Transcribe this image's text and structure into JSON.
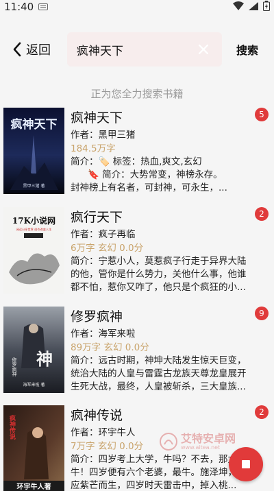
{
  "status_bar": {
    "time": "11:40"
  },
  "header": {
    "back_label": "返回",
    "search_value": "疯神天下",
    "search_button": "搜索"
  },
  "status_message": "正为您全力搜索书籍",
  "results": [
    {
      "title": "疯神天下",
      "badge": "5",
      "author": "作者：黑甲三猪",
      "meta": "184.5万字",
      "intro1": "简介：🏷️ 标签：热血,爽文,玄幻",
      "intro2": "🔖 简介：大势常变，神榜永存。",
      "intro3": "封神榜上有名者，可封神，可永生，...",
      "cover": {
        "line1": "疯神天下",
        "line2": "黑甲三猪 著"
      }
    },
    {
      "title": "疯行天下",
      "badge": "2",
      "author": "作者：疯子再临",
      "meta": "6万字  玄幻  0.0分",
      "intro1": "简介：宁惹小人，莫惹疯子行走于异界大陆",
      "intro2": "的他，管你是什么势力，关他什么事，他谁",
      "intro3": "都不怕，惹你又咋了，他只是个疯狂的小...",
      "cover": {
        "line1": "17K小说网",
        "line2": "阅读分享世界  创作改变人生"
      }
    },
    {
      "title": "修罗疯神",
      "badge": "9",
      "author": "作者：海军来啦",
      "meta": "89万字  玄幻  0.0分",
      "intro1": "简介：远古时期，神坤大陆发生惊天巨变，",
      "intro2": "统治大陆的人皇与雷霆古龙族天尊龙皇展开",
      "intro3": "生死大战，最终，人皇被斩杀，三大皇族...",
      "cover": {
        "line1": "修罗疯神",
        "line2": "海军来啦 著"
      }
    },
    {
      "title": "疯神传说",
      "badge": "2",
      "author": "作者：环宇牛人",
      "meta": "7万字  玄幻  0.0分",
      "intro1": "简介：四岁考上大学，牛吗？不去，那太",
      "intro2": "牛！四岁便有六个老婆，最牛。施泽坤，",
      "intro3": "应紫芒而生，四岁时天雷击中，掉入桃...",
      "cover": {
        "line1": "疯神传说",
        "line2": "环宇牛人著"
      }
    }
  ],
  "watermark": {
    "name": "艾特安卓网",
    "domain": "www.aitea.net"
  },
  "colors": {
    "accent": "#e13a3a",
    "meta": "#c9a46c",
    "search_bg": "#f7eded"
  }
}
